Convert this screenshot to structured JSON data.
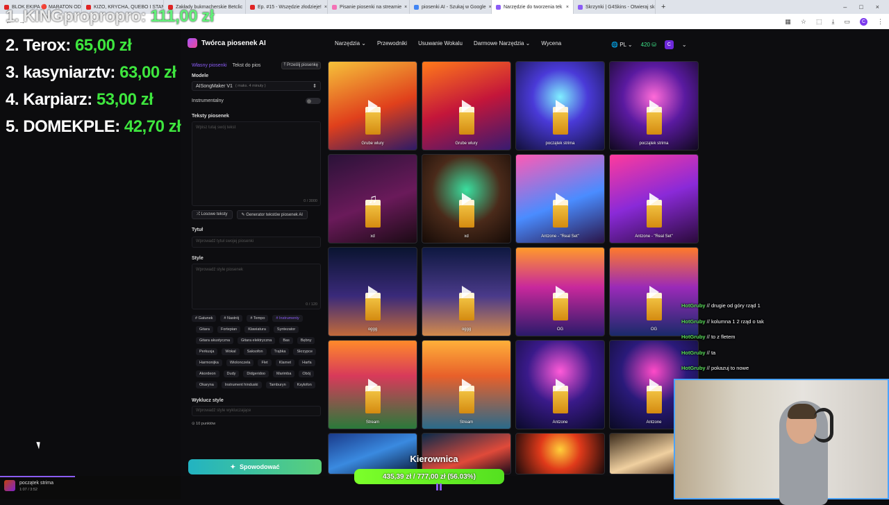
{
  "browser": {
    "tabs": [
      {
        "label": "BLOK EKIPA 🔴 MARATON OD",
        "fav": "#e02424",
        "active": false
      },
      {
        "label": "KIZO, KRYCHA, QUEBO I STAN",
        "fav": "#e02424",
        "active": false
      },
      {
        "label": "Zakłady bukmacherskie Betclic",
        "fav": "#e02424",
        "active": false
      },
      {
        "label": "Ep. #15 - Wszędzie złodzieje!",
        "fav": "#e02424",
        "active": false
      },
      {
        "label": "Pisanie piosenki na streamie",
        "fav": "#f472b6",
        "active": false
      },
      {
        "label": "piosenki AI - Szukaj w Google",
        "fav": "#4285f4",
        "active": false
      },
      {
        "label": "Narzędzie do tworzenia tek",
        "fav": "#8b5cf6",
        "active": true
      },
      {
        "label": "Skrzynki | G4Skins - Otwieraj sk",
        "fav": "#8b5cf6",
        "active": false
      }
    ]
  },
  "leaderboard": [
    {
      "rank": "1.",
      "name": "KINGpropropro:",
      "amount": "111,00 zł"
    },
    {
      "rank": "2.",
      "name": "Terox:",
      "amount": "65,00 zł"
    },
    {
      "rank": "3.",
      "name": "kasyniarztv:",
      "amount": "63,00 zł"
    },
    {
      "rank": "4.",
      "name": "Karpiarz:",
      "amount": "53,00 zł"
    },
    {
      "rank": "5.",
      "name": "DOMEKPLE:",
      "amount": "42,70 zł"
    }
  ],
  "site": {
    "logo": "Twórca piosenek AI",
    "nav": [
      "Narzędzia",
      "Przewodniki",
      "Usuwanie Wokalu",
      "Darmowe Narzędzia",
      "Wycena"
    ],
    "lang": "PL",
    "credits": "420",
    "user_initial": "C"
  },
  "panel": {
    "tab_active": "Własny piosenki",
    "tab_other": "Tekst do pios",
    "upload": "Prześlij piosenkę",
    "model_label": "Modele",
    "model_value": "AISongMaker V1",
    "model_sub": "( maks. 4 minuty )",
    "instrumental": "Instrumentalny",
    "lyrics_label": "Teksty piosenek",
    "lyrics_placeholder": "Wpisz tutaj swój tekst",
    "lyrics_counter": "0 / 3000",
    "random_btn": "Losowe teksty",
    "gen_lyrics_btn": "Generator tekstów piosenek AI",
    "title_label": "Tytuł",
    "title_placeholder": "Wprowadź tytuł swojej piosenki",
    "style_label": "Style",
    "style_placeholder": "Wprowadź style piosenek",
    "style_counter": "0 / 120",
    "style_tabs": [
      "# Gatunek",
      "# Nastrój",
      "# Tempo",
      "# Instrumenty"
    ],
    "instruments": [
      "Gitara",
      "Fortepian",
      "Klawiatura",
      "Syntezator",
      "Gitara akustyczna",
      "Gitara elektryczna",
      "Bas",
      "Bębny",
      "Perkusja",
      "Wokal",
      "Saksofon",
      "Trąbka",
      "Skrzypce",
      "Harmonijka",
      "Wiolonczela",
      "Flet",
      "Klarnet",
      "Harfa",
      "Akordeon",
      "Dudy",
      "Didgeridoo",
      "Marimba",
      "Obój",
      "Okaryna",
      "Instrument hinduski",
      "Tamburyn",
      "Ksylofon"
    ],
    "exclude_label": "Wyklucz style",
    "exclude_placeholder": "Wprowadź style wykluczające",
    "points": "10 punktów",
    "generate": "Spowodować"
  },
  "songs": [
    {
      "caption": "Grube wlury",
      "bg": "linear-gradient(160deg,#f6c23a,#e0401c 55%,#2d1a66)",
      "icon": "play"
    },
    {
      "caption": "Grube wlury",
      "bg": "linear-gradient(160deg,#ff7a1a,#c4163a 50%,#381a70)",
      "icon": "play"
    },
    {
      "caption": "początek strima",
      "bg": "radial-gradient(circle at 50% 40%,#7ff0ff,#4a3ad8 40%,#12103a)",
      "icon": "play"
    },
    {
      "caption": "początek strima",
      "bg": "radial-gradient(circle at 50% 40%,#ff6ad8,#5a1aa0 45%,#10081e)",
      "icon": "play"
    },
    {
      "caption": "xd",
      "bg": "linear-gradient(160deg,#2a1238,#6a1a5a 55%,#1a0a14)",
      "icon": "note"
    },
    {
      "caption": "xd",
      "bg": "radial-gradient(circle at 50% 40%,#3ae0a0,#4a2a1a 50%,#140a06)",
      "icon": "play"
    },
    {
      "caption": "Antzone - \"Real Set\"",
      "bg": "linear-gradient(160deg,#ff5ab4,#4a8cff 55%,#2a1448)",
      "icon": "play"
    },
    {
      "caption": "Antzone - \"Real Set\"",
      "bg": "linear-gradient(160deg,#ff3a9c,#8a2ad8 50%,#2a0a3a)",
      "icon": "play"
    },
    {
      "caption": "oggg",
      "bg": "linear-gradient(180deg,#0a1430,#3a2a7a 55%,#c26a3a)",
      "icon": "play"
    },
    {
      "caption": "oggg",
      "bg": "linear-gradient(180deg,#0e1840,#4a3a8a 55%,#d48a4a)",
      "icon": "play"
    },
    {
      "caption": "OG",
      "bg": "linear-gradient(180deg,#ff9a2a,#c8289c 45%,#2a1a6a)",
      "icon": "play"
    },
    {
      "caption": "OG",
      "bg": "linear-gradient(180deg,#ff7a2a,#9a2ab8 45%,#1a2a6a)",
      "icon": "play"
    },
    {
      "caption": "Stream",
      "bg": "linear-gradient(180deg,#ff8a2a,#d83a5a 40%,#2a7a3a)",
      "icon": "play"
    },
    {
      "caption": "Stream",
      "bg": "linear-gradient(180deg,#ffb03a,#e8602a 40%,#2a6a8a)",
      "icon": "play"
    },
    {
      "caption": "Antzone",
      "bg": "radial-gradient(circle at 50% 35%,#ff5ad8,#3a1a8a 45%,#0a0a2a)",
      "icon": "play"
    },
    {
      "caption": "Antzone",
      "bg": "radial-gradient(circle at 50% 35%,#ff4ac8,#2a1a7a 45%,#0a0a24)",
      "icon": "play"
    },
    {
      "caption": "",
      "bg": "linear-gradient(160deg,#1a3a8a,#3a8ae0 50%,#0a1a3a)",
      "icon": "none"
    },
    {
      "caption": "",
      "bg": "linear-gradient(160deg,#0a2a4a,#e04a3a 60%,#1a0a1a)",
      "icon": "none"
    },
    {
      "caption": "",
      "bg": "radial-gradient(circle at 50% 40%,#ffd03a,#e03a1a 40%,#1a0a0a)",
      "icon": "none"
    },
    {
      "caption": "",
      "bg": "linear-gradient(160deg,#3a2a1a,#f0d0a0 55%,#3a1a0a)",
      "icon": "none"
    }
  ],
  "chat": [
    {
      "user": "HotGruby",
      "msg": "drugie od góry rząd 1"
    },
    {
      "user": "HotGruby",
      "msg": "kolumna 1 2 rząd o tak"
    },
    {
      "user": "HotGruby",
      "msg": "to z fletem"
    },
    {
      "user": "HotGruby",
      "msg": "ta"
    },
    {
      "user": "HotGruby",
      "msg": "pokazuj to nowe"
    }
  ],
  "goal": {
    "title": "Kierownica",
    "progress": "435,39 zł / 777,00 zł (56.03%)",
    "fraction": 0.5603
  },
  "player": {
    "track": "początek strima",
    "time": "1:07 / 3:52"
  }
}
